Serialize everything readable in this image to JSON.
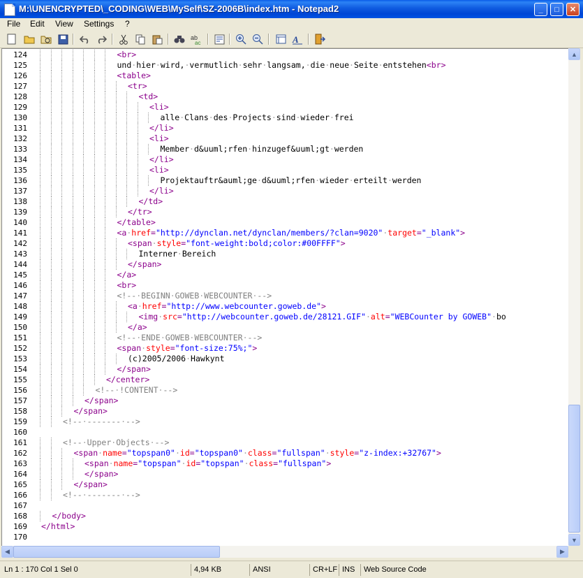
{
  "window": {
    "title": "M:\\UNENCRYPTED\\_CODING\\WEB\\MySelf\\SZ-2006B\\index.htm - Notepad2",
    "buttons": {
      "minimize": "_",
      "maximize": "□",
      "close": "✕"
    }
  },
  "menu": [
    {
      "label": "File"
    },
    {
      "label": "Edit"
    },
    {
      "label": "View"
    },
    {
      "label": "Settings"
    },
    {
      "label": "?"
    }
  ],
  "toolbar": {
    "icons": [
      "new-file-icon",
      "open-file-icon",
      "browse-icon",
      "save-icon",
      "undo-icon",
      "redo-icon",
      "cut-icon",
      "copy-icon",
      "paste-icon",
      "find-icon",
      "replace-icon",
      "word-wrap-icon",
      "zoom-in-icon",
      "zoom-out-icon",
      "scheme-icon",
      "font-icon",
      "exit-icon"
    ]
  },
  "editor": {
    "lines": [
      {
        "n": "124",
        "depth": 7,
        "text": "<br>"
      },
      {
        "n": "125",
        "depth": 7,
        "text": "und hier wird, vermutlich sehr langsam, die neue Seite entstehen<br>"
      },
      {
        "n": "126",
        "depth": 7,
        "text": "<table>"
      },
      {
        "n": "127",
        "depth": 8,
        "text": "<tr>"
      },
      {
        "n": "128",
        "depth": 9,
        "text": "<td>"
      },
      {
        "n": "129",
        "depth": 10,
        "text": "<li>"
      },
      {
        "n": "130",
        "depth": 11,
        "text": "alle Clans des Projects sind wieder frei"
      },
      {
        "n": "131",
        "depth": 10,
        "text": "</li>"
      },
      {
        "n": "132",
        "depth": 10,
        "text": "<li>"
      },
      {
        "n": "133",
        "depth": 11,
        "text": "Member d&uuml;rfen hinzugef&uuml;gt werden"
      },
      {
        "n": "134",
        "depth": 10,
        "text": "</li>"
      },
      {
        "n": "135",
        "depth": 10,
        "text": "<li>"
      },
      {
        "n": "136",
        "depth": 11,
        "text": "Projektauftr&auml;ge d&uuml;rfen wieder erteilt werden"
      },
      {
        "n": "137",
        "depth": 10,
        "text": "</li>"
      },
      {
        "n": "138",
        "depth": 9,
        "text": "</td>"
      },
      {
        "n": "139",
        "depth": 8,
        "text": "</tr>"
      },
      {
        "n": "140",
        "depth": 7,
        "text": "</table>"
      },
      {
        "n": "141",
        "depth": 7,
        "text": "<a href=\"http://dynclan.net/dynclan/members/?clan=9020\" target=\"_blank\">"
      },
      {
        "n": "142",
        "depth": 8,
        "text": "<span style=\"font-weight:bold;color:#00FFFF\">"
      },
      {
        "n": "143",
        "depth": 9,
        "text": "Interner Bereich"
      },
      {
        "n": "144",
        "depth": 8,
        "text": "</span>"
      },
      {
        "n": "145",
        "depth": 7,
        "text": "</a>"
      },
      {
        "n": "146",
        "depth": 7,
        "text": "<br>"
      },
      {
        "n": "147",
        "depth": 7,
        "text": "<!-- BEGINN GOWEB WEBCOUNTER -->"
      },
      {
        "n": "148",
        "depth": 8,
        "text": "<a href=\"http://www.webcounter.goweb.de\">"
      },
      {
        "n": "149",
        "depth": 9,
        "text": "<img src=\"http://webcounter.goweb.de/28121.GIF\" alt=\"WEBCounter by GOWEB\" bo"
      },
      {
        "n": "150",
        "depth": 8,
        "text": "</a>"
      },
      {
        "n": "151",
        "depth": 7,
        "text": "<!-- ENDE GOWEB WEBCOUNTER -->"
      },
      {
        "n": "152",
        "depth": 7,
        "text": "<span style=\"font-size:75%;\">"
      },
      {
        "n": "153",
        "depth": 8,
        "text": "(c)2005/2006 Hawkynt"
      },
      {
        "n": "154",
        "depth": 7,
        "text": "</span>"
      },
      {
        "n": "155",
        "depth": 6,
        "text": "</center>"
      },
      {
        "n": "156",
        "depth": 5,
        "text": "<!-- !CONTENT -->"
      },
      {
        "n": "157",
        "depth": 4,
        "text": "</span>"
      },
      {
        "n": "158",
        "depth": 3,
        "text": "</span>"
      },
      {
        "n": "159",
        "depth": 2,
        "text": "<!-- ------- -->"
      },
      {
        "n": "160",
        "depth": 0,
        "text": ""
      },
      {
        "n": "161",
        "depth": 2,
        "text": "<!-- Upper Objects -->"
      },
      {
        "n": "162",
        "depth": 3,
        "text": "<span name=\"topspan0\" id=\"topspan0\" class=\"fullspan\" style=\"z-index:+32767\">"
      },
      {
        "n": "163",
        "depth": 4,
        "text": "<span name=\"topspan\" id=\"topspan\" class=\"fullspan\">"
      },
      {
        "n": "164",
        "depth": 4,
        "text": "</span>"
      },
      {
        "n": "165",
        "depth": 3,
        "text": "</span>"
      },
      {
        "n": "166",
        "depth": 2,
        "text": "<!-- ------- -->"
      },
      {
        "n": "167",
        "depth": 0,
        "text": ""
      },
      {
        "n": "168",
        "depth": 1,
        "text": "</body>"
      },
      {
        "n": "169",
        "depth": 0,
        "text": "</html>"
      },
      {
        "n": "170",
        "depth": 0,
        "text": ""
      }
    ]
  },
  "statusbar": {
    "position": "Ln 1 : 170   Col 1   Sel 0",
    "size": "4,94 KB",
    "encoding": "ANSI",
    "eol": "CR+LF",
    "mode": "INS",
    "scheme": "Web Source Code"
  }
}
